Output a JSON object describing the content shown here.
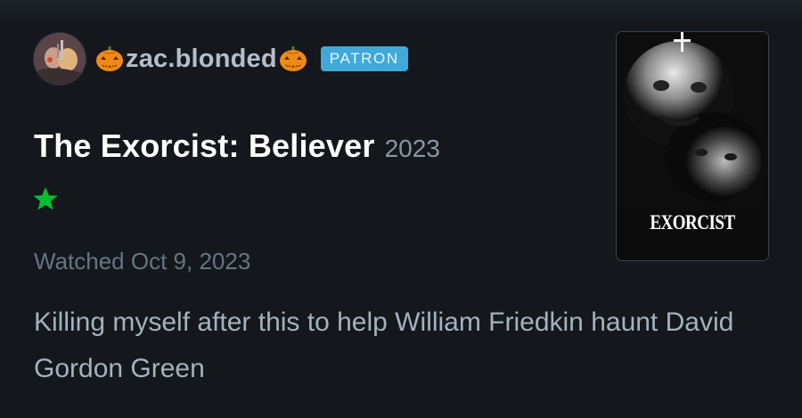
{
  "review": {
    "username": "zac.blonded",
    "badge": "PATRON",
    "film_title": "The Exorcist: Believer",
    "film_year": "2023",
    "rating_stars": 1,
    "watched_label": "Watched Oct 9, 2023",
    "body": "Killing myself after this to help William Friedkin haunt David Gordon Green"
  },
  "poster": {
    "title_text": "EXORCIST"
  },
  "icons": {
    "avatar": "user-avatar",
    "left_emoji": "jack-o-lantern-icon",
    "right_emoji": "jack-o-lantern-icon",
    "rating": "star-icon"
  },
  "colors": {
    "background": "#14181c",
    "badge": "#3fa9d9",
    "star": "#00c030",
    "username": "#b4bec9",
    "muted": "#667583"
  }
}
